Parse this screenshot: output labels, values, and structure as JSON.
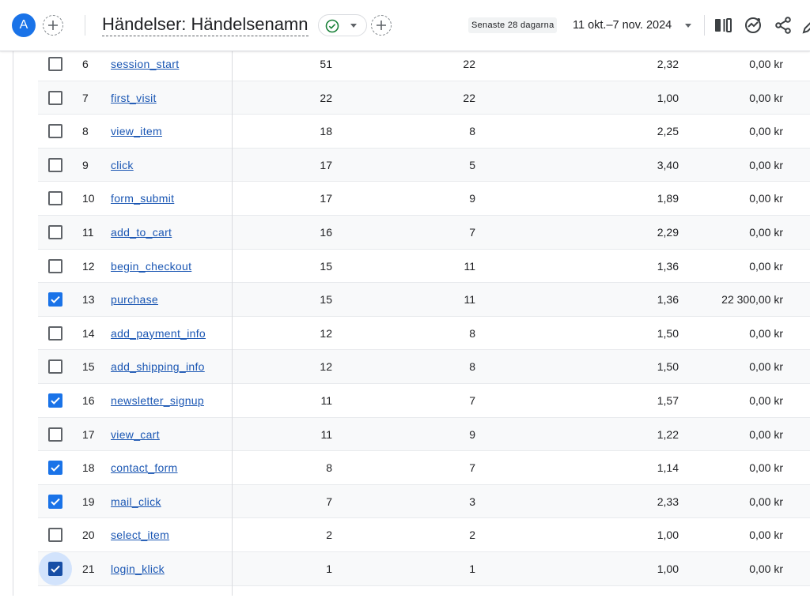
{
  "header": {
    "avatar_letter": "A",
    "title": "Händelser: Händelsenamn",
    "date_badge": "Senaste 28 dagarna",
    "date_range": "11 okt.–7 nov. 2024"
  },
  "colors": {
    "accent": "#1a73e8",
    "link": "#1a56b3",
    "status_ok": "#188038"
  },
  "table": {
    "rows": [
      {
        "index": "6",
        "name": "session_start",
        "event_count": "51",
        "total_users": "22",
        "per_user": "2,32",
        "revenue": "0,00 kr",
        "checked": false
      },
      {
        "index": "7",
        "name": "first_visit",
        "event_count": "22",
        "total_users": "22",
        "per_user": "1,00",
        "revenue": "0,00 kr",
        "checked": false
      },
      {
        "index": "8",
        "name": "view_item",
        "event_count": "18",
        "total_users": "8",
        "per_user": "2,25",
        "revenue": "0,00 kr",
        "checked": false
      },
      {
        "index": "9",
        "name": "click",
        "event_count": "17",
        "total_users": "5",
        "per_user": "3,40",
        "revenue": "0,00 kr",
        "checked": false
      },
      {
        "index": "10",
        "name": "form_submit",
        "event_count": "17",
        "total_users": "9",
        "per_user": "1,89",
        "revenue": "0,00 kr",
        "checked": false
      },
      {
        "index": "11",
        "name": "add_to_cart",
        "event_count": "16",
        "total_users": "7",
        "per_user": "2,29",
        "revenue": "0,00 kr",
        "checked": false
      },
      {
        "index": "12",
        "name": "begin_checkout",
        "event_count": "15",
        "total_users": "11",
        "per_user": "1,36",
        "revenue": "0,00 kr",
        "checked": false
      },
      {
        "index": "13",
        "name": "purchase",
        "event_count": "15",
        "total_users": "11",
        "per_user": "1,36",
        "revenue": "22 300,00 kr",
        "checked": true
      },
      {
        "index": "14",
        "name": "add_payment_info",
        "event_count": "12",
        "total_users": "8",
        "per_user": "1,50",
        "revenue": "0,00 kr",
        "checked": false
      },
      {
        "index": "15",
        "name": "add_shipping_info",
        "event_count": "12",
        "total_users": "8",
        "per_user": "1,50",
        "revenue": "0,00 kr",
        "checked": false
      },
      {
        "index": "16",
        "name": "newsletter_signup",
        "event_count": "11",
        "total_users": "7",
        "per_user": "1,57",
        "revenue": "0,00 kr",
        "checked": true
      },
      {
        "index": "17",
        "name": "view_cart",
        "event_count": "11",
        "total_users": "9",
        "per_user": "1,22",
        "revenue": "0,00 kr",
        "checked": false
      },
      {
        "index": "18",
        "name": "contact_form",
        "event_count": "8",
        "total_users": "7",
        "per_user": "1,14",
        "revenue": "0,00 kr",
        "checked": true
      },
      {
        "index": "19",
        "name": "mail_click",
        "event_count": "7",
        "total_users": "3",
        "per_user": "2,33",
        "revenue": "0,00 kr",
        "checked": true
      },
      {
        "index": "20",
        "name": "select_item",
        "event_count": "2",
        "total_users": "2",
        "per_user": "1,00",
        "revenue": "0,00 kr",
        "checked": false
      },
      {
        "index": "21",
        "name": "login_klick",
        "event_count": "1",
        "total_users": "1",
        "per_user": "1,00",
        "revenue": "0,00 kr",
        "checked": true,
        "focused": true
      }
    ]
  }
}
